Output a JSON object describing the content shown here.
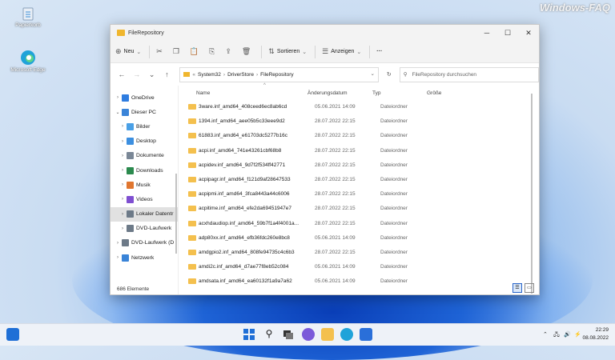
{
  "watermark": "Windows-FAQ",
  "desktop_icons": [
    {
      "label": "Papierkorb",
      "icon": "recycle-bin-icon"
    },
    {
      "label": "Microsoft Edge",
      "icon": "edge-icon"
    }
  ],
  "window": {
    "title": "FileRepository",
    "controls": {
      "minimize": "─",
      "maximize": "☐",
      "close": "✕"
    }
  },
  "toolbar": {
    "new_label": "Neu",
    "sort_label": "Sortieren",
    "view_label": "Anzeigen",
    "more_label": "···"
  },
  "address": {
    "crumbs": [
      "System32",
      "DriverStore",
      "FileRepository"
    ],
    "search_placeholder": "FileRepository durchsuchen"
  },
  "nav": {
    "items": [
      {
        "label": "OneDrive",
        "level": 0,
        "color": "#2f7de0"
      },
      {
        "label": "Dieser PC",
        "level": 0,
        "color": "#3a84d8",
        "expanded": true
      },
      {
        "label": "Bilder",
        "level": 1,
        "color": "#4aa0e6"
      },
      {
        "label": "Desktop",
        "level": 1,
        "color": "#3c8fe0"
      },
      {
        "label": "Dokumente",
        "level": 1,
        "color": "#7a8796"
      },
      {
        "label": "Downloads",
        "level": 1,
        "color": "#2b8a4e"
      },
      {
        "label": "Musik",
        "level": 1,
        "color": "#e0762f"
      },
      {
        "label": "Videos",
        "level": 1,
        "color": "#7f4fd1"
      },
      {
        "label": "Lokaler Datentr",
        "level": 1,
        "color": "#6d7a88",
        "selected": true
      },
      {
        "label": "DVD-Laufwerk",
        "level": 1,
        "color": "#6d7a88"
      },
      {
        "label": "DVD-Laufwerk (D",
        "level": 0,
        "color": "#6d7a88"
      },
      {
        "label": "Netzwerk",
        "level": 0,
        "color": "#3a84d8"
      }
    ]
  },
  "columns": {
    "name": "Name",
    "date": "Änderungsdatum",
    "type": "Typ",
    "size": "Größe"
  },
  "files": [
    {
      "name": "3ware.inf_amd64_408ceed6ec8ab6cd",
      "date": "05.06.2021 14:09",
      "type": "Dateiordner"
    },
    {
      "name": "1394.inf_amd64_aee05b5c33eee9d2",
      "date": "28.07.2022 22:15",
      "type": "Dateiordner"
    },
    {
      "name": "61883.inf_amd64_e61703dc5277b16c",
      "date": "28.07.2022 22:15",
      "type": "Dateiordner"
    },
    {
      "name": "acpi.inf_amd64_741e43261cbf68b8",
      "date": "28.07.2022 22:15",
      "type": "Dateiordner"
    },
    {
      "name": "acpidev.inf_amd64_9d7f2f534ff42771",
      "date": "28.07.2022 22:15",
      "type": "Dateiordner"
    },
    {
      "name": "acpipagr.inf_amd64_f121d9af28647533",
      "date": "28.07.2022 22:15",
      "type": "Dateiordner"
    },
    {
      "name": "acpipmi.inf_amd64_3fca8443a44c6006",
      "date": "28.07.2022 22:15",
      "type": "Dateiordner"
    },
    {
      "name": "acpitime.inf_amd64_efe2da69451947e7",
      "date": "28.07.2022 22:15",
      "type": "Dateiordner"
    },
    {
      "name": "acxhdaudiop.inf_amd64_59b7f1a4f4001a...",
      "date": "28.07.2022 22:15",
      "type": "Dateiordner"
    },
    {
      "name": "adp80xx.inf_amd64_efb36fdc260e8bc8",
      "date": "05.06.2021 14:09",
      "type": "Dateiordner"
    },
    {
      "name": "amdgpio2.inf_amd64_808fe94735c4c6b3",
      "date": "28.07.2022 22:15",
      "type": "Dateiordner"
    },
    {
      "name": "amdi2c.inf_amd64_d7ae77f8eb52c084",
      "date": "05.06.2021 14:09",
      "type": "Dateiordner"
    },
    {
      "name": "amdsata.inf_amd64_ea60132f1a9a7a62",
      "date": "05.06.2021 14:09",
      "type": "Dateiordner"
    }
  ],
  "status": {
    "count": "686 Elemente"
  },
  "taskbar": {
    "time": "22:29",
    "date": "08.08.2022",
    "colors": {
      "start": "#1f6fd6",
      "accent": "#2a65c8"
    }
  }
}
